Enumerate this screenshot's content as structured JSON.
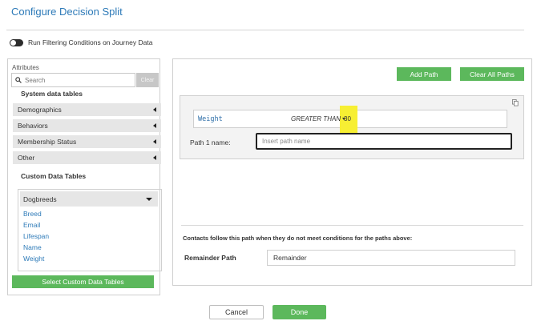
{
  "dialog": {
    "title": "Configure Decision Split",
    "toggle_label": "Run Filtering Conditions on Journey Data"
  },
  "attributes": {
    "label": "Attributes",
    "search_placeholder": "Search",
    "clear_label": "Clear",
    "system_heading": "System data tables",
    "system_tables": [
      {
        "label": "Demographics"
      },
      {
        "label": "Behaviors"
      },
      {
        "label": "Membership Status"
      },
      {
        "label": "Other"
      }
    ],
    "custom_heading": "Custom Data Tables",
    "custom_table": {
      "name": "Dogbreeds",
      "fields": [
        "Breed",
        "Email",
        "Lifespan",
        "Name",
        "Weight"
      ]
    },
    "select_button": "Select Custom Data Tables"
  },
  "paths": {
    "add_path": "Add Path",
    "clear_all": "Clear All Paths",
    "path1": {
      "attribute": "Weight",
      "operator": "GREATER THAN",
      "value": "30",
      "name_label": "Path 1 name:",
      "name_placeholder": "Insert path name",
      "name_value": ""
    },
    "remainder": {
      "note": "Contacts follow this path when they do not meet conditions for the paths above:",
      "label": "Remainder Path",
      "value": "Remainder"
    }
  },
  "footer": {
    "cancel": "Cancel",
    "done": "Done"
  },
  "colors": {
    "accent_blue": "#2d7ab8",
    "green": "#5cb85c",
    "highlight": "#f7ef33"
  }
}
